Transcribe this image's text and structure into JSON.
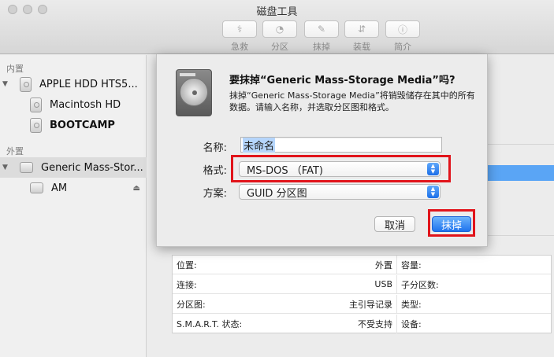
{
  "window": {
    "title": "磁盘工具"
  },
  "toolbar": {
    "items": [
      {
        "label": "急救",
        "icon": "stethoscope-icon"
      },
      {
        "label": "分区",
        "icon": "pie-chart-icon"
      },
      {
        "label": "抹掉",
        "icon": "eraser-icon"
      },
      {
        "label": "装载",
        "icon": "mount-icon"
      },
      {
        "label": "简介",
        "icon": "info-icon"
      }
    ]
  },
  "sidebar": {
    "internal_header": "内置",
    "external_header": "外置",
    "internal_items": [
      {
        "label": "APPLE HDD HTS5..."
      },
      {
        "label": "Macintosh HD"
      },
      {
        "label": "BOOTCAMP"
      }
    ],
    "external_items": [
      {
        "label": "Generic Mass-Stor..."
      },
      {
        "label": "AM"
      }
    ]
  },
  "dialog": {
    "title": "要抹掉“Generic Mass-Storage Media”吗?",
    "message": "抹掉“Generic Mass-Storage Media”将销毁储存在其中的所有数据。请输入名称，并选取分区图和格式。",
    "name_label": "名称:",
    "name_value": "未命名",
    "format_label": "格式:",
    "format_value": "MS-DOS （FAT)",
    "scheme_label": "方案:",
    "scheme_value": "GUID 分区图",
    "cancel_label": "取消",
    "erase_label": "抹掉"
  },
  "info_table": {
    "left": [
      {
        "key": "位置:",
        "value": "外置"
      },
      {
        "key": "连接:",
        "value": "USB"
      },
      {
        "key": "分区图:",
        "value": "主引导记录"
      },
      {
        "key": "S.M.A.R.T. 状态:",
        "value": "不受支持"
      }
    ],
    "right": [
      {
        "key": "容量:",
        "value": ""
      },
      {
        "key": "子分区数:",
        "value": ""
      },
      {
        "key": "类型:",
        "value": ""
      },
      {
        "key": "设备:",
        "value": ""
      }
    ]
  },
  "colors": {
    "accent": "#1f73ee",
    "highlight_box": "#e1141b",
    "selection": "#b5d5fb"
  }
}
